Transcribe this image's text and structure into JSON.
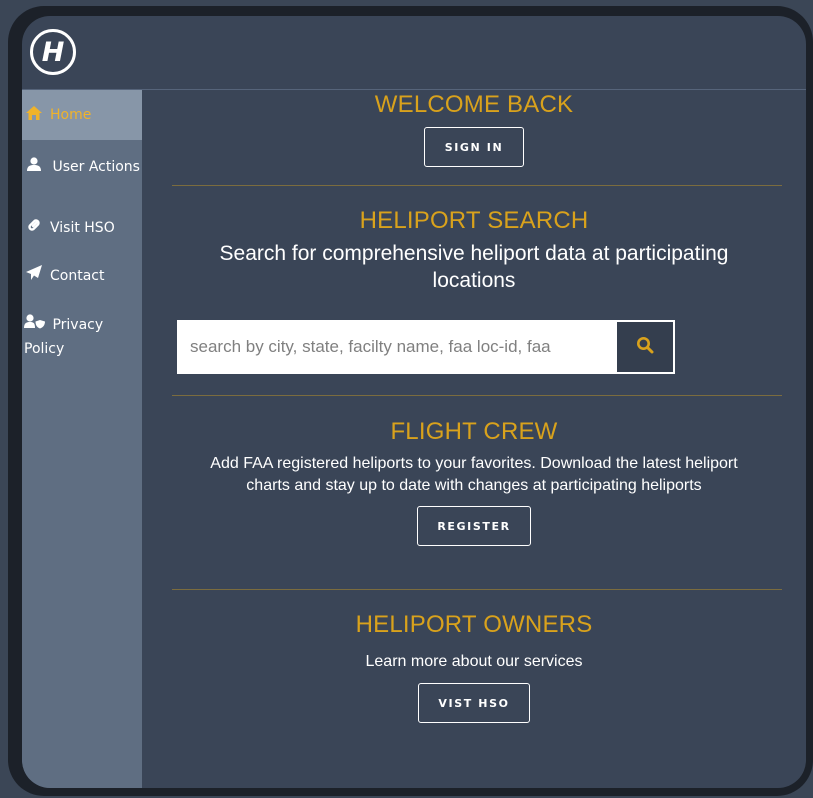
{
  "logo": {
    "letter": "H"
  },
  "sidebar": {
    "items": [
      {
        "label": "Home",
        "icon": "home-icon"
      },
      {
        "label": "User Actions",
        "icon": "user-icon"
      },
      {
        "label": "Visit HSO",
        "icon": "link-icon"
      },
      {
        "label": "Contact",
        "icon": "paper-plane-icon"
      },
      {
        "label": "Privacy Policy",
        "icon": "user-shield-icon"
      }
    ]
  },
  "welcome": {
    "heading": "WELCOME BACK",
    "button": "SIGN IN"
  },
  "search": {
    "heading": "HELIPORT SEARCH",
    "subheading": "Search for comprehensive heliport data at participating locations",
    "placeholder": "search by city, state, facilty name, faa loc-id, faa",
    "icon": "search-icon"
  },
  "flight_crew": {
    "heading": "FLIGHT CREW",
    "text": "Add FAA registered heliports to your favorites. Download the latest heliport charts and stay up to date with changes at participating heliports",
    "button": "REGISTER"
  },
  "owners": {
    "heading": "HELIPORT OWNERS",
    "text": "Learn more about our services",
    "button": "VIST HSO"
  },
  "colors": {
    "accent": "#d9a21c",
    "background": "#3a4557",
    "sidebar": "#5f6e82",
    "sidebar_active": "#8796a8"
  }
}
